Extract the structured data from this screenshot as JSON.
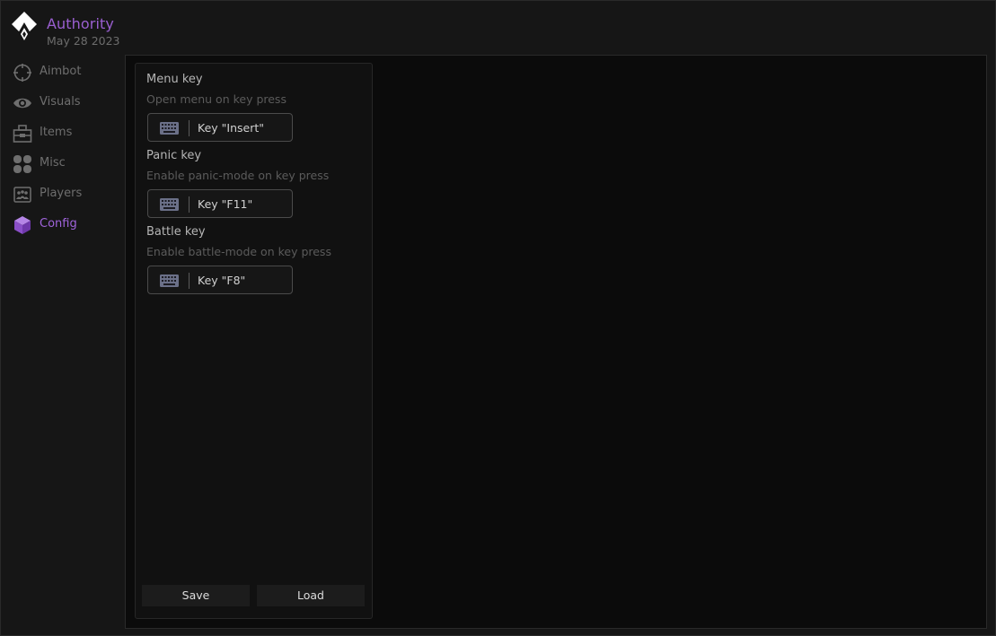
{
  "app": {
    "name": "Authority",
    "date": "May 28 2023",
    "accent_color": "#9a5fd0"
  },
  "sidebar": {
    "items": [
      {
        "label": "Aimbot",
        "icon": "crosshair-icon",
        "active": false
      },
      {
        "label": "Visuals",
        "icon": "eye-icon",
        "active": false
      },
      {
        "label": "Items",
        "icon": "toolbox-icon",
        "active": false
      },
      {
        "label": "Misc",
        "icon": "grid-icon",
        "active": false
      },
      {
        "label": "Players",
        "icon": "players-icon",
        "active": false
      },
      {
        "label": "Config",
        "icon": "cube-icon",
        "active": true
      }
    ]
  },
  "config": {
    "settings": [
      {
        "title": "Menu key",
        "description": "Open menu on key press",
        "key": "Key \"Insert\"",
        "icon": "keyboard-icon"
      },
      {
        "title": "Panic key",
        "description": "Enable panic-mode on key press",
        "key": "Key \"F11\"",
        "icon": "keyboard-icon"
      },
      {
        "title": "Battle key",
        "description": "Enable battle-mode on key press",
        "key": "Key \"F8\"",
        "icon": "keyboard-icon"
      }
    ],
    "save_label": "Save",
    "load_label": "Load"
  }
}
